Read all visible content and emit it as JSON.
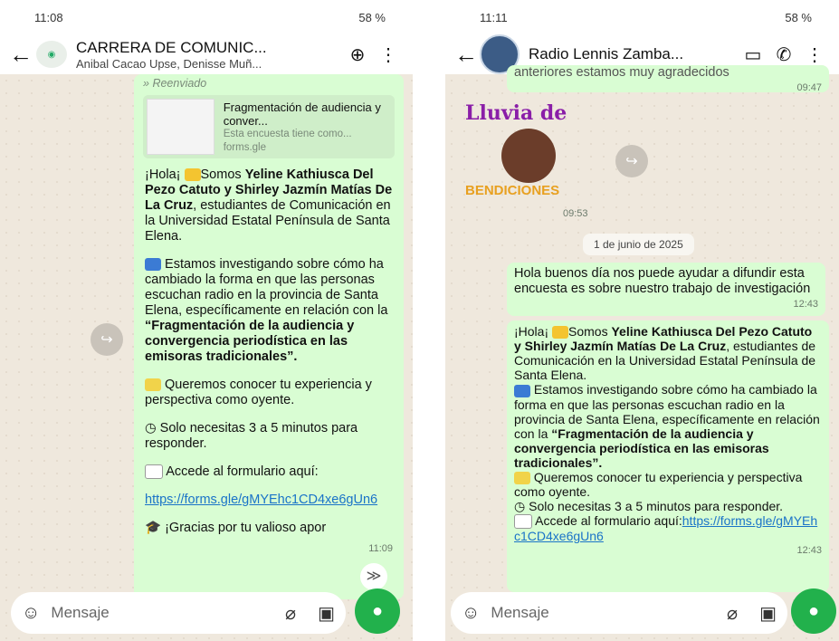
{
  "left": {
    "status": {
      "time": "11:08",
      "right": "58 %"
    },
    "header": {
      "title": "CARRERA DE COMUNIC...",
      "subtitle": "Anibal Cacao Upse, Denisse Muñ..."
    },
    "message": {
      "forwarded": "Reenviado",
      "preview_title": "Fragmentación de audiencia y conver...",
      "preview_desc": "Esta encuesta tiene como...",
      "preview_domain": "forms.gle",
      "p1_a": "¡Hola¡ ",
      "p1_b": "Somos ",
      "p1_names": "Yeline Kathiusca Del Pezo Catuto y Shirley Jazmín Matías De La Cruz",
      "p1_c": ", estudiantes de Comunicación en la Universidad Estatal Península de Santa Elena.",
      "p2_a": " Estamos investigando sobre cómo ha cambiado la forma en que las personas escuchan radio en la provincia de Santa Elena, específicamente en relación con la ",
      "p2_b": "“Fragmentación de la audiencia y convergencia periodística en las emisoras tradicionales”.",
      "p3": " Queremos conocer tu experiencia y perspectiva como oyente.",
      "p4": " Solo necesitas 3 a 5 minutos para responder.",
      "p5": " Accede al formulario aquí:",
      "link": "https://forms.gle/gMYEhc1CD4xe6gUn6",
      "p6": " ¡Gracias por tu valioso apor",
      "time": "11:09"
    },
    "composer": {
      "placeholder": "Mensaje"
    }
  },
  "right": {
    "status": {
      "time": "11:11",
      "right": "58 %"
    },
    "header": {
      "title": "Radio Lennis Zamba..."
    },
    "top_partial": "anteriores estamos muy agradecidos",
    "top_time": "09:47",
    "sticker": {
      "line1": "Lluvia de",
      "line2": "BENDICIONES",
      "time": "09:53"
    },
    "date": "1 de junio de 2025",
    "msg1": {
      "text": "Hola buenos día nos puede ayudar a difundir esta encuesta es sobre nuestro trabajo de investigación",
      "time": "12:43"
    },
    "msg2": {
      "a": "¡Hola¡ ",
      "b": "Somos ",
      "names": "Yeline Kathiusca Del Pezo Catuto y Shirley Jazmín Matías De La Cruz",
      "c": ", estudiantes de Comunicación en la Universidad Estatal Península de Santa Elena.",
      "d": " Estamos investigando sobre cómo ha cambiado la forma en que las personas escuchan radio en la provincia de Santa Elena, específicamente en relación con la ",
      "e": "“Fragmentación de la audiencia y convergencia periodística en las emisoras tradicionales”.",
      "f": " Queremos conocer tu experiencia y perspectiva como oyente.",
      "g": " Solo necesitas 3 a 5 minutos para responder.",
      "h": " Accede al formulario aquí:",
      "link": "https://forms.gle/gMYEhc1CD4xe6gUn6",
      "time": "12:43"
    },
    "composer": {
      "placeholder": "Mensaje"
    }
  },
  "colors": {
    "bubble": "#d9fdd3",
    "accent": "#22b14c",
    "link": "#1a73c8"
  }
}
